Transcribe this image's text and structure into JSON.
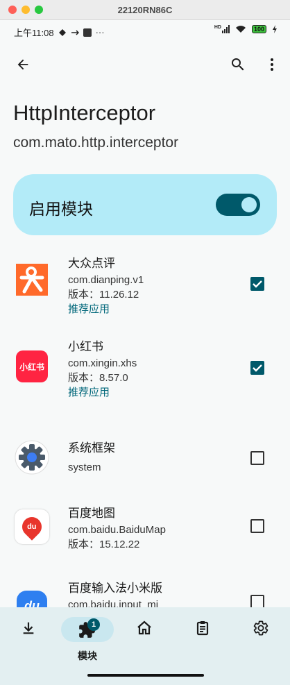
{
  "window": {
    "title": "22120RN86C"
  },
  "statusbar": {
    "time": "上午11:08",
    "more": "···",
    "battery": "100",
    "network": "HD"
  },
  "appbar": {
    "back_icon": "arrow-back-icon",
    "search_icon": "search-icon",
    "menu_icon": "more-vert-icon"
  },
  "app": {
    "title": "HttpInterceptor",
    "package": "com.mato.http.interceptor"
  },
  "enable_card": {
    "label": "启用模块",
    "enabled": true
  },
  "modules": [
    {
      "name": "大众点评",
      "package": "com.dianping.v1",
      "version": "版本：11.26.12",
      "tag": "推荐应用",
      "checked": true,
      "icon": "dianping-icon"
    },
    {
      "name": "小红书",
      "package": "com.xingin.xhs",
      "version": "版本：8.57.0",
      "tag": "推荐应用",
      "checked": true,
      "icon": "xiaohongshu-icon",
      "icon_text": "小红书"
    },
    {
      "name": "系统框架",
      "package": "system",
      "checked": false,
      "icon": "android-settings-icon"
    },
    {
      "name": "百度地图",
      "package": "com.baidu.BaiduMap",
      "version": "版本：15.12.22",
      "checked": false,
      "icon": "baidu-map-icon",
      "icon_text": "du"
    },
    {
      "name": "百度输入法小米版",
      "package": "com.baidu.input_mi",
      "checked": false,
      "icon": "baidu-input-icon",
      "icon_text": "du"
    }
  ],
  "bottomnav": {
    "items": [
      {
        "icon": "download-icon"
      },
      {
        "icon": "modules-icon",
        "label": "模块",
        "badge": "1",
        "active": true
      },
      {
        "icon": "home-icon"
      },
      {
        "icon": "logs-icon"
      },
      {
        "icon": "settings-icon"
      }
    ]
  }
}
